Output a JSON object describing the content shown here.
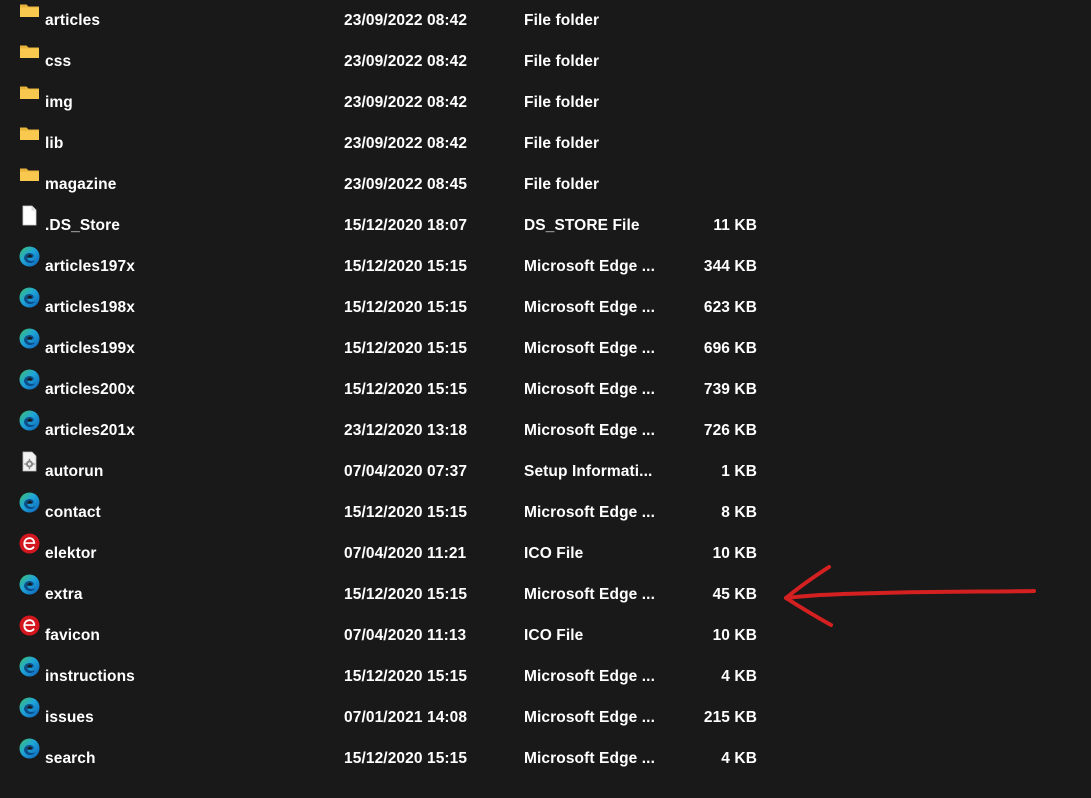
{
  "rows": [
    {
      "name": "articles",
      "date": "23/09/2022 08:42",
      "type": "File folder",
      "size": "",
      "icon": "folder-icon"
    },
    {
      "name": "css",
      "date": "23/09/2022 08:42",
      "type": "File folder",
      "size": "",
      "icon": "folder-icon"
    },
    {
      "name": "img",
      "date": "23/09/2022 08:42",
      "type": "File folder",
      "size": "",
      "icon": "folder-icon"
    },
    {
      "name": "lib",
      "date": "23/09/2022 08:42",
      "type": "File folder",
      "size": "",
      "icon": "folder-icon"
    },
    {
      "name": "magazine",
      "date": "23/09/2022 08:45",
      "type": "File folder",
      "size": "",
      "icon": "folder-icon"
    },
    {
      "name": ".DS_Store",
      "date": "15/12/2020 18:07",
      "type": "DS_STORE File",
      "size": "11 KB",
      "icon": "file-icon"
    },
    {
      "name": "articles197x",
      "date": "15/12/2020 15:15",
      "type": "Microsoft Edge ...",
      "size": "344 KB",
      "icon": "edge-icon"
    },
    {
      "name": "articles198x",
      "date": "15/12/2020 15:15",
      "type": "Microsoft Edge ...",
      "size": "623 KB",
      "icon": "edge-icon"
    },
    {
      "name": "articles199x",
      "date": "15/12/2020 15:15",
      "type": "Microsoft Edge ...",
      "size": "696 KB",
      "icon": "edge-icon"
    },
    {
      "name": "articles200x",
      "date": "15/12/2020 15:15",
      "type": "Microsoft Edge ...",
      "size": "739 KB",
      "icon": "edge-icon"
    },
    {
      "name": "articles201x",
      "date": "23/12/2020 13:18",
      "type": "Microsoft Edge ...",
      "size": "726 KB",
      "icon": "edge-icon"
    },
    {
      "name": "autorun",
      "date": "07/04/2020 07:37",
      "type": "Setup Informati...",
      "size": "1 KB",
      "icon": "setup-file-icon"
    },
    {
      "name": "contact",
      "date": "15/12/2020 15:15",
      "type": "Microsoft Edge ...",
      "size": "8 KB",
      "icon": "edge-icon"
    },
    {
      "name": "elektor",
      "date": "07/04/2020 11:21",
      "type": "ICO File",
      "size": "10 KB",
      "icon": "elektor-icon"
    },
    {
      "name": "extra",
      "date": "15/12/2020 15:15",
      "type": "Microsoft Edge ...",
      "size": "45 KB",
      "icon": "edge-icon"
    },
    {
      "name": "favicon",
      "date": "07/04/2020 11:13",
      "type": "ICO File",
      "size": "10 KB",
      "icon": "elektor-icon"
    },
    {
      "name": "instructions",
      "date": "15/12/2020 15:15",
      "type": "Microsoft Edge ...",
      "size": "4 KB",
      "icon": "edge-icon"
    },
    {
      "name": "issues",
      "date": "07/01/2021 14:08",
      "type": "Microsoft Edge ...",
      "size": "215 KB",
      "icon": "edge-icon"
    },
    {
      "name": "search",
      "date": "15/12/2020 15:15",
      "type": "Microsoft Edge ...",
      "size": "4 KB",
      "icon": "edge-icon"
    }
  ],
  "annotation": {
    "target_row": "extra",
    "icon": "red-arrow-annotation",
    "color": "#d42020"
  },
  "colors": {
    "background": "#191919",
    "text": "#ffffff",
    "folder": "#f8c94e",
    "edge_blue": "#1f8fd8",
    "edge_green": "#3fc06a",
    "elektor_red": "#d4161f"
  }
}
